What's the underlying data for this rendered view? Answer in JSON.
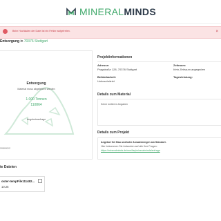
{
  "brand": {
    "mineral": "MINERAL",
    "minds": "MINDS",
    "accent": "#3fa86a",
    "dark": "#2e3b4a"
  },
  "alert": {
    "text": "Beim Hochladen der Datei ist ein Fehler aufgetreten.",
    "close": "×",
    "color": "#e05a63"
  },
  "title": {
    "prefix": "Entsorgung",
    "in_word": "in",
    "location": "70376 Stuttgart"
  },
  "card": {
    "heading": "Entsorgung",
    "subtitle": "Material muss abgefahren werden",
    "quantity": "1.000 Tonnen",
    "weight": "110864",
    "offer": "Angebotsanfrage",
    "id": "205092/2"
  },
  "project_info": {
    "title": "Projektinformationen",
    "address_label": "Adresse:",
    "address_value": "Pragstraße 128, 70376 Stuttgart",
    "period_label": "Zeitraum:",
    "period_value": "Kein Zeitraum angegeben",
    "drivability_label": "Befahrbarkeit:",
    "drivability_value": "Unbeschränkt",
    "daily_label": "Tagesleistung:",
    "daily_value": ""
  },
  "material": {
    "title": "Details zum Material",
    "text": "Keine weiteren Angaben"
  },
  "project": {
    "title": "Details zum Projekt",
    "line1": "Angebot frei Bau und/oder Ansatzmengen am Standort.",
    "line2": "Hier bekommen Sie Antworten auf alle Ihre Fragen:",
    "link": "https://mineralminds.de/mm/faq/mineralminds/anfrage"
  },
  "files": {
    "title": "te Dateien",
    "items": [
      {
        "name": "oster-tempFile111482...",
        "date": "10.25"
      }
    ]
  }
}
